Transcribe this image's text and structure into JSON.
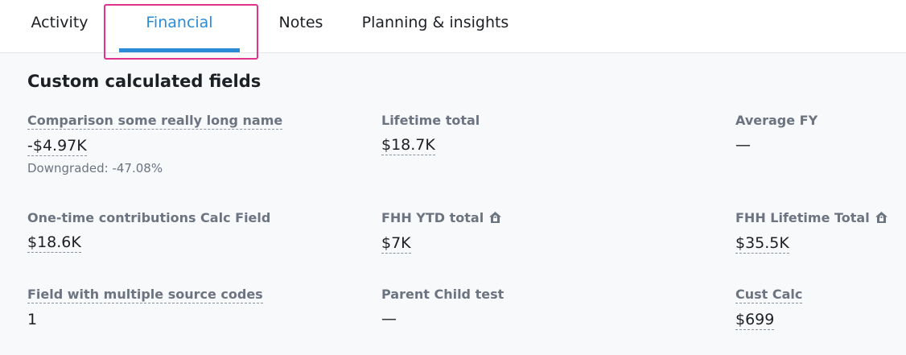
{
  "tabs": [
    {
      "label": "Activity"
    },
    {
      "label": "Financial"
    },
    {
      "label": "Notes"
    },
    {
      "label": "Planning & insights"
    }
  ],
  "section": {
    "title": "Custom calculated fields"
  },
  "fields": {
    "comparison": {
      "label": "Comparison some really long name",
      "value": "-$4.97K",
      "sub": "Downgraded: -47.08%"
    },
    "lifetime_total": {
      "label": "Lifetime total",
      "value": "$18.7K"
    },
    "average_fy": {
      "label": "Average FY",
      "value": "—"
    },
    "one_time": {
      "label": "One-time contributions Calc Field",
      "value": "$18.6K"
    },
    "fhh_ytd": {
      "label": "FHH YTD total",
      "value": "$7K",
      "icon": "house-lock-icon"
    },
    "fhh_lifetime": {
      "label": "FHH Lifetime Total",
      "value": "$35.5K",
      "icon": "house-lock-icon"
    },
    "multi_source": {
      "label": "Field with multiple source codes",
      "value": "1"
    },
    "parent_child": {
      "label": "Parent Child test",
      "value": "—"
    },
    "cust_calc": {
      "label": "Cust Calc",
      "value": "$699"
    }
  },
  "colors": {
    "accent": "#2b8bd6",
    "highlight": "#e0338c",
    "label": "#6b7480"
  }
}
